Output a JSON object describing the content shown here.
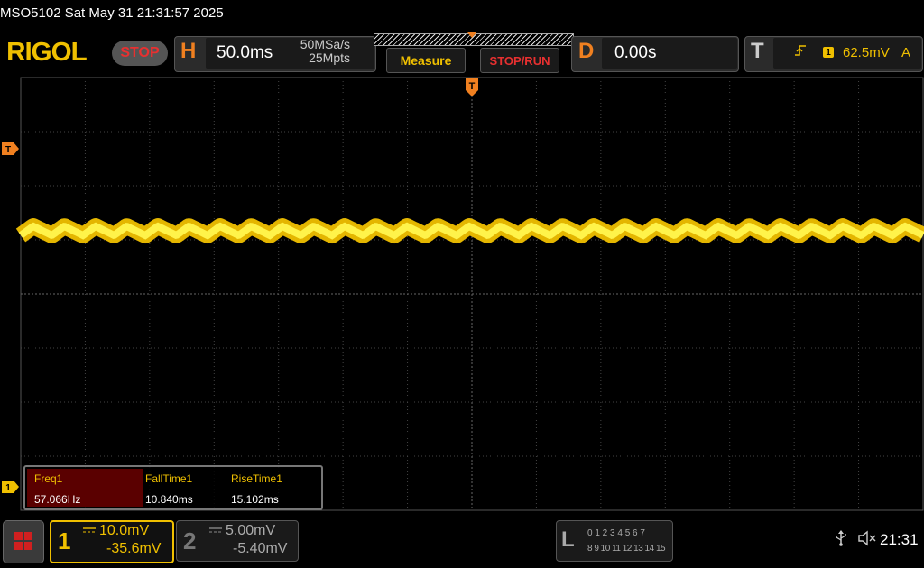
{
  "header": {
    "title": "MSO5102  Sat May 31 21:31:57 2025",
    "logo": "RIGOL",
    "status": "STOP"
  },
  "horizontal": {
    "letter": "H",
    "timebase": "50.0ms",
    "sample_rate": "50MSa/s",
    "memory_depth": "25Mpts"
  },
  "buttons": {
    "measure": "Measure",
    "stop_run": "STOP/RUN"
  },
  "delay": {
    "letter": "D",
    "value": "0.00s"
  },
  "trigger": {
    "letter": "T",
    "edge_icon": "rising-edge-icon",
    "source": "1",
    "level": "62.5mV",
    "mode": "A"
  },
  "screen_markers": {
    "trigger_top": "T",
    "trigger_level": "T",
    "channel1": "1"
  },
  "measurements": [
    {
      "label": "Freq1",
      "value": "57.066Hz",
      "highlight": true
    },
    {
      "label": "FallTime1",
      "value": "10.840ms",
      "highlight": false
    },
    {
      "label": "RiseTime1",
      "value": "15.102ms",
      "highlight": false
    }
  ],
  "channels": [
    {
      "number": "1",
      "coupling": "DC",
      "scale": "10.0mV",
      "offset": "-35.6mV",
      "color": "#f0c000",
      "active": true
    },
    {
      "number": "2",
      "coupling": "DC",
      "scale": "5.00mV",
      "offset": "-5.40mV",
      "color": "#888888",
      "active": false
    }
  ],
  "logic_analyzer": {
    "letter": "L",
    "row1": "0 1 2 3  4 5 6 7",
    "row2": "8 9 10 11 12 13 14 15"
  },
  "status_bar": {
    "usb_icon": "usb-icon",
    "speaker_icon": "speaker-muted-icon",
    "time": "21:31"
  },
  "colors": {
    "ch1": "#f0c000",
    "accent": "#f08020",
    "stop": "#e83030"
  }
}
